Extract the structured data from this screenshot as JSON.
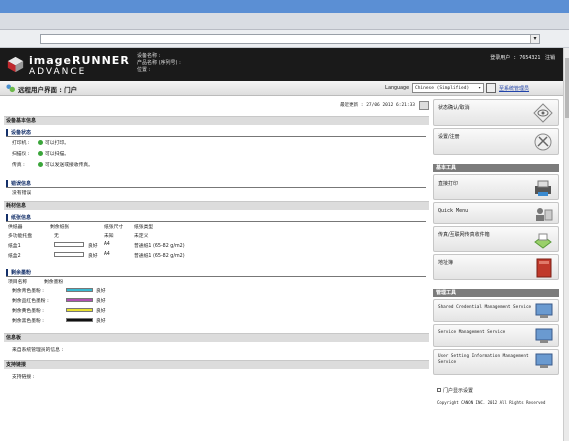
{
  "header": {
    "brand_line1": "imageRUNNER",
    "brand_line2": "ADVANCE",
    "device_name_label": "设备名称 :",
    "product_name_label": "产品名称 (序列号) :",
    "location_label": "位置 :",
    "login_user": "登录用户 : 7654321",
    "logout": "注销"
  },
  "titlebar": {
    "title": "远程用户界面 : 门户",
    "language_label": "Language",
    "language_value": "Chinese (Simplified)",
    "mail_link": "至系统管理员"
  },
  "main": {
    "last_updated": "最近更新 : 27/06 2012 6:21:33",
    "device_basic_info": "设备基本信息",
    "device_status": "设备状态",
    "status_rows": [
      {
        "label": "打印机 :",
        "value": "可以打印。"
      },
      {
        "label": "扫描仪 :",
        "value": "可以扫描。"
      },
      {
        "label": "传真 :",
        "value": "可以发送或接收传真。"
      }
    ],
    "error_info": "错误信息",
    "error_none": "没有错误",
    "consumables_info": "耗材信息",
    "paper_info": "纸张信息",
    "paper_headers": [
      "供纸器",
      "剩余纸张",
      "纸张尺寸",
      "纸张类型"
    ],
    "paper_rows": [
      {
        "source": "多功能托盘",
        "remaining": "无",
        "size": "未知",
        "type": "未定义"
      },
      {
        "source": "纸盒1",
        "remaining": "良好",
        "size": "A4",
        "type": "普通纸1 (65-82 g/m2)"
      },
      {
        "source": "纸盒2",
        "remaining": "良好",
        "size": "A4",
        "type": "普通纸1 (65-82 g/m2)"
      }
    ],
    "toner_info": "剩余墨粉",
    "toner_headers": [
      "项目名称",
      "剩余墨粉"
    ],
    "toner_rows": [
      {
        "label": "剩余青色墨粉 :",
        "color": "#38b8d0",
        "status": "良好"
      },
      {
        "label": "剩余品红色墨粉 :",
        "color": "#b050b0",
        "status": "良好"
      },
      {
        "label": "剩余黄色墨粉 :",
        "color": "#e8e030",
        "status": "良好"
      },
      {
        "label": "剩余黑色墨粉 :",
        "color": "#111111",
        "status": "良好"
      }
    ],
    "messages": "信息板",
    "messages_text": "来自系统管理员的信息 :",
    "support": "支持链接",
    "support_text": "支持链接 :"
  },
  "side": {
    "status_monitor": "状态确认/取消",
    "settings": "设置/注册",
    "basic_tools": "基本工具",
    "direct_print": "直接打印",
    "quick_menu": "Quick Menu",
    "fax_inbox": "传真/互联网传真收件箱",
    "address_book": "地址簿",
    "management_tools": "管理工具",
    "shared_cred": "Shared Credential Management Service",
    "service_mgmt": "Service Management Service",
    "user_setting": "User Setting Information Management Service",
    "portal_display": "门户显示设置",
    "copyright": "Copyright CANON INC. 2012 All Rights Reserved"
  }
}
